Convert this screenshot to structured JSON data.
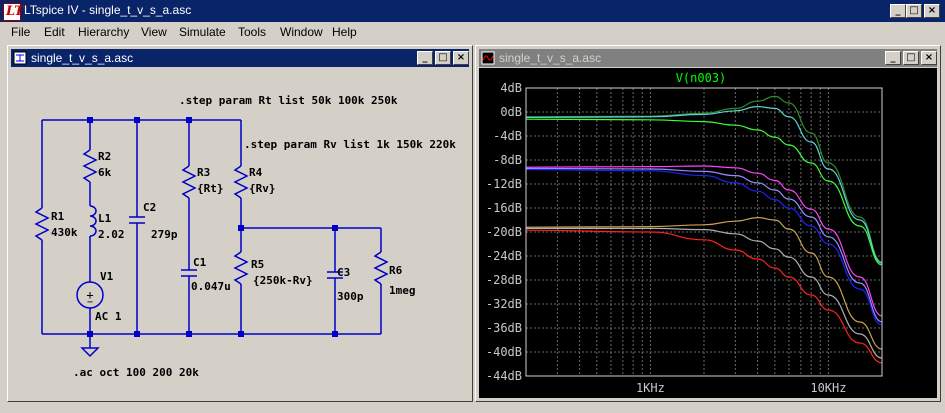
{
  "app": {
    "title": "LTspice IV - single_t_v_s_a.asc"
  },
  "menu": [
    "File",
    "Edit",
    "Hierarchy",
    "View",
    "Simulate",
    "Tools",
    "Window",
    "Help"
  ],
  "schematic_window": {
    "title": "single_t_v_s_a.asc",
    "directives": {
      "step_rt": ".step param Rt list 50k 100k 250k",
      "step_rv": ".step param Rv list 1k 150k 220k",
      "ac": ".ac oct 100 200 20k"
    },
    "components": {
      "r1": {
        "name": "R1",
        "value": "430k"
      },
      "r2": {
        "name": "R2",
        "value": "6k"
      },
      "l1": {
        "name": "L1",
        "value": "2.02"
      },
      "v1": {
        "name": "V1",
        "value": "AC 1"
      },
      "c2": {
        "name": "C2",
        "value": "279p"
      },
      "r3": {
        "name": "R3",
        "value": "{Rt}"
      },
      "c1": {
        "name": "C1",
        "value": "0.047u"
      },
      "r4": {
        "name": "R4",
        "value": "{Rv}"
      },
      "r5": {
        "name": "R5",
        "value": "{250k-Rv}"
      },
      "c3": {
        "name": "C3",
        "value": "300p"
      },
      "r6": {
        "name": "R6",
        "value": "1meg"
      }
    }
  },
  "plot_window": {
    "title": "single_t_v_s_a.asc",
    "chart_data": {
      "type": "line",
      "title": "V(n003)",
      "xscale": "log",
      "xlim": [
        200,
        20000
      ],
      "ylim": [
        -44,
        4
      ],
      "ytick_labels": [
        "4dB",
        "0dB",
        "-4dB",
        "-8dB",
        "-12dB",
        "-16dB",
        "-20dB",
        "-24dB",
        "-28dB",
        "-32dB",
        "-36dB",
        "-40dB",
        "-44dB"
      ],
      "ytick_values": [
        4,
        0,
        -4,
        -8,
        -12,
        -16,
        -20,
        -24,
        -28,
        -32,
        -36,
        -40,
        -44
      ],
      "xtick_labels": [
        "1KHz",
        "10KHz"
      ],
      "xtick_values": [
        1000,
        10000
      ],
      "grid": true,
      "background": "#000000",
      "title_color": "#00ff00",
      "series": [
        {
          "color": "#2e8b2e",
          "x": [
            200,
            1000,
            2000,
            3000,
            4000,
            5000,
            6000,
            8000,
            10000,
            15000,
            20000
          ],
          "y": [
            -0.8,
            -0.7,
            -0.2,
            0.6,
            1.8,
            2.6,
            1.5,
            -3.5,
            -8.5,
            -17.5,
            -25.0
          ]
        },
        {
          "color": "#5fd3d3",
          "x": [
            200,
            1000,
            2000,
            3000,
            4000,
            5000,
            6000,
            8000,
            10000,
            15000,
            20000
          ],
          "y": [
            -0.9,
            -0.8,
            -0.4,
            0.2,
            0.9,
            0.6,
            -0.8,
            -5.0,
            -9.5,
            -18.0,
            -25.2
          ]
        },
        {
          "color": "#3cff3c",
          "x": [
            200,
            1000,
            2000,
            3000,
            4000,
            5000,
            6000,
            8000,
            10000,
            15000,
            20000
          ],
          "y": [
            -1.2,
            -1.3,
            -1.6,
            -2.2,
            -3.0,
            -4.2,
            -5.5,
            -8.5,
            -11.5,
            -19.0,
            -25.5
          ]
        },
        {
          "color": "#ff40ff",
          "x": [
            200,
            1000,
            2000,
            3000,
            4000,
            5000,
            6000,
            8000,
            10000,
            15000,
            20000
          ],
          "y": [
            -9.2,
            -9.1,
            -9.0,
            -9.3,
            -10.2,
            -11.4,
            -13.0,
            -16.2,
            -19.5,
            -27.5,
            -34.0
          ]
        },
        {
          "color": "#9090ff",
          "x": [
            200,
            1000,
            2000,
            3000,
            4000,
            5000,
            6000,
            8000,
            10000,
            15000,
            20000
          ],
          "y": [
            -9.4,
            -9.5,
            -9.9,
            -10.6,
            -11.8,
            -13.0,
            -14.5,
            -17.5,
            -20.8,
            -28.5,
            -35.0
          ]
        },
        {
          "color": "#2020ff",
          "x": [
            200,
            1000,
            2000,
            3000,
            4000,
            5000,
            6000,
            8000,
            10000,
            15000,
            20000
          ],
          "y": [
            -9.6,
            -9.8,
            -10.6,
            -11.8,
            -13.2,
            -14.6,
            -16.0,
            -19.0,
            -22.0,
            -29.5,
            -35.5
          ]
        },
        {
          "color": "#c8a050",
          "x": [
            200,
            1000,
            2000,
            3000,
            4000,
            5000,
            6000,
            8000,
            10000,
            15000,
            20000
          ],
          "y": [
            -19.2,
            -19.1,
            -18.8,
            -18.2,
            -17.6,
            -18.0,
            -19.5,
            -23.5,
            -27.5,
            -35.0,
            -39.5
          ]
        },
        {
          "color": "#b0b0b0",
          "x": [
            200,
            1000,
            2000,
            3000,
            4000,
            5000,
            6000,
            8000,
            10000,
            15000,
            20000
          ],
          "y": [
            -19.4,
            -19.4,
            -19.6,
            -20.3,
            -21.5,
            -22.8,
            -24.2,
            -27.5,
            -30.5,
            -37.0,
            -41.0
          ]
        },
        {
          "color": "#ff2020",
          "x": [
            200,
            1000,
            2000,
            3000,
            4000,
            5000,
            6000,
            8000,
            10000,
            15000,
            20000
          ],
          "y": [
            -19.7,
            -20.0,
            -21.3,
            -23.0,
            -24.5,
            -26.0,
            -27.5,
            -30.5,
            -33.0,
            -38.5,
            -41.8
          ]
        }
      ]
    }
  }
}
